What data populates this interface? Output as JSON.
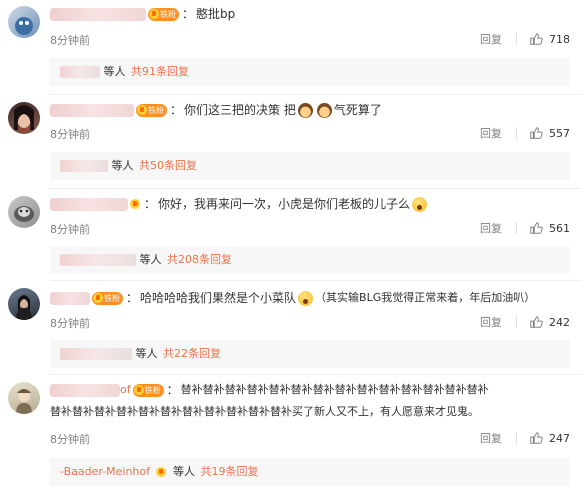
{
  "comments": [
    {
      "badge": "铁粉",
      "colon": "：",
      "text": "憨批bp",
      "time": "8分钟前",
      "reply_label": "回复",
      "likes": "718",
      "reply_names_suffix": "等人",
      "reply_total": "共91条回复"
    },
    {
      "badge": "铁粉",
      "colon": "：",
      "text_a": "你们这三把的决策 把",
      "text_b": "气死算了",
      "time": "8分钟前",
      "reply_label": "回复",
      "likes": "557",
      "reply_names_suffix": "等人",
      "reply_total": "共50条回复"
    },
    {
      "colon": "：",
      "text": "你好，我再来问一次，小虎是你们老板的儿子么",
      "time": "8分钟前",
      "reply_label": "回复",
      "likes": "561",
      "reply_names_suffix": "等人",
      "reply_total": "共208条回复"
    },
    {
      "badge": "铁粉",
      "colon": "：",
      "text_a": "哈哈哈哈我们果然是个小菜队",
      "text_b": "（其实输BLG我觉得正常来着，年后加油叭）",
      "time": "8分钟前",
      "reply_label": "回复",
      "likes": "242",
      "reply_names_suffix": "等人",
      "reply_total": "共22条回复"
    },
    {
      "visible_name_tail": "of",
      "badge": "铁粉",
      "colon": "：",
      "text_line1": "替补替补替补替补替补替补替补替补替补替补替补替补替补替补",
      "text_line2": "替补替补替补替补替补替补替补替补替补替补替补买了新人又不上，有人愿意来才见鬼。",
      "time": "8分钟前",
      "reply_label": "回复",
      "likes": "247",
      "reply_name": "-Baader-Meinhof",
      "reply_names_suffix": "等人",
      "reply_total": "共19条回复"
    }
  ],
  "icons": {
    "like": "thumb-up-icon",
    "badge": "vip-fan-badge-icon"
  },
  "colors": {
    "link_orange": "#eb7350",
    "badge_orange": "#ff8f1f",
    "muted": "#808080",
    "reply_bg": "#f7f7f7"
  }
}
